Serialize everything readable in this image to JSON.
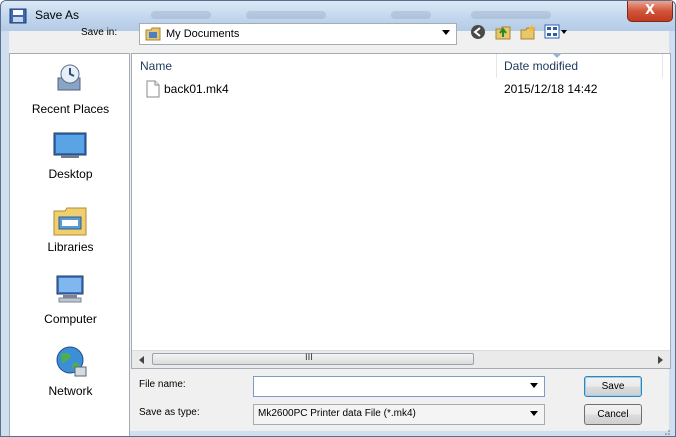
{
  "window": {
    "title": "Save As",
    "close_glyph": "X"
  },
  "toolbar": {
    "save_in_label": "Save in:",
    "location": "My Documents",
    "icons": [
      "back-icon",
      "up-folder-icon",
      "new-folder-icon",
      "view-menu-icon"
    ]
  },
  "places": [
    {
      "label": "Recent Places",
      "icon": "recent-places-icon"
    },
    {
      "label": "Desktop",
      "icon": "desktop-icon"
    },
    {
      "label": "Libraries",
      "icon": "libraries-icon"
    },
    {
      "label": "Computer",
      "icon": "computer-icon"
    },
    {
      "label": "Network",
      "icon": "network-icon"
    }
  ],
  "file_list": {
    "columns": [
      "Name",
      "Date modified"
    ],
    "rows": [
      {
        "name": "back01.mk4",
        "date_modified": "2015/12/18 14:42"
      }
    ],
    "scroll_grip": "III"
  },
  "form": {
    "file_name_label": "File name:",
    "file_name_value": "",
    "save_type_label": "Save as type:",
    "save_type_value": "Mk2600PC Printer data File (*.mk4)"
  },
  "buttons": {
    "save": "Save",
    "cancel": "Cancel"
  }
}
